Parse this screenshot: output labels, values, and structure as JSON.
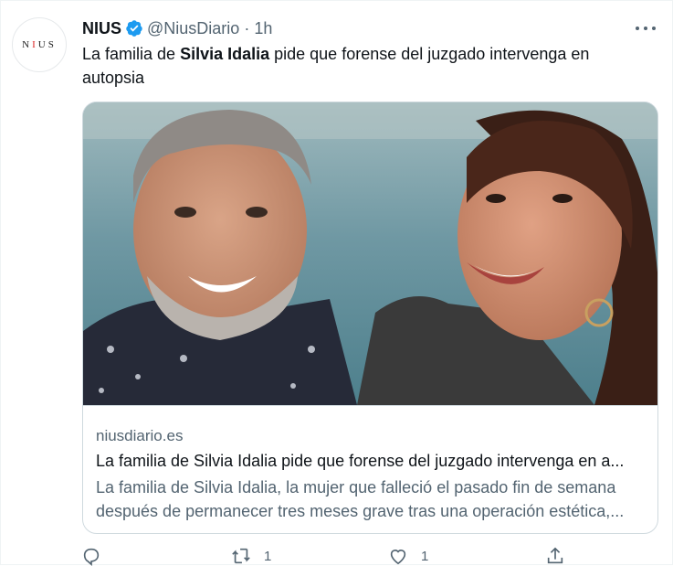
{
  "author": {
    "display_name": "NIUS",
    "handle": "@NiusDiario",
    "separator": "·",
    "time": "1h",
    "avatar_text": "NIUS",
    "verified_color": "#1d9bf0"
  },
  "tweet": {
    "text_pre": "La familia de ",
    "text_bold": "Silvia Idalia",
    "text_post": " pide que forense del juzgado intervenga en autopsia"
  },
  "card": {
    "domain": "niusdiario.es",
    "title": "La familia de Silvia Idalia pide que forense del juzgado intervenga en a...",
    "description_line1": "La familia de Silvia Idalia, la mujer que falleció el pasado fin de semana",
    "description_line2": "después de permanecer tres meses grave tras una operación estética,..."
  },
  "actions": {
    "reply_icon": "reply-icon",
    "retweet_icon": "retweet-icon",
    "retweet_count": "1",
    "like_icon": "heart-icon",
    "like_count": "1",
    "share_icon": "share-icon"
  },
  "colors": {
    "text": "#0f1419",
    "secondary": "#536471",
    "border": "#cfd9de",
    "accent": "#1d9bf0"
  }
}
